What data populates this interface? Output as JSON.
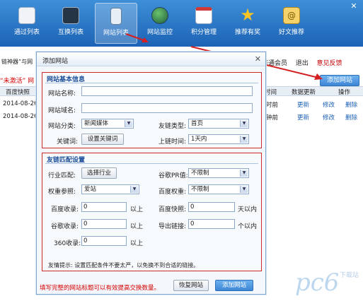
{
  "toolbar": {
    "items": [
      {
        "label": "通过列表",
        "icon": "clipboard-icon"
      },
      {
        "label": "互换列表",
        "icon": "monitor-icon"
      },
      {
        "label": "网站列表",
        "icon": "phone-icon"
      },
      {
        "label": "网站监控",
        "icon": "globe-icon"
      },
      {
        "label": "积分管理",
        "icon": "calendar-icon"
      },
      {
        "label": "推荐有奖",
        "icon": "star-icon"
      },
      {
        "label": "好文推荐",
        "icon": "mail-icon"
      }
    ],
    "active_index": 2
  },
  "background": {
    "app_title_fragment": "链神器”与网",
    "unactivated_text": "“未激活” 网",
    "header_left": "百度快照",
    "rows": [
      {
        "date": "2014-08-26",
        "time": "时前",
        "update": "更新",
        "edit": "修改",
        "delete": "删除"
      },
      {
        "date": "2014-08-26",
        "time": "钟前",
        "update": "更新",
        "edit": "修改",
        "delete": "删除"
      }
    ],
    "top_right": {
      "member": "普通会员",
      "logout": "退出",
      "feedback": "意见反馈"
    },
    "add_site_button": "添加网站",
    "columns": {
      "time": "时间",
      "data_update": "数据更新",
      "action": "操作"
    }
  },
  "dialog": {
    "title": "添加网站",
    "basic": {
      "group_title": "网站基本信息",
      "site_name_label": "网站名称:",
      "site_name_value": "",
      "site_alias_label": "网站域名:",
      "site_alias_value": "",
      "category_label": "网站分类:",
      "category_value": "新闻媒体",
      "link_type_label": "友链类型:",
      "link_type_value": "首页",
      "keyword_label": "关键词:",
      "keyword_button": "设置关键词",
      "link_time_label": "上链时间:",
      "link_time_value": "1天内"
    },
    "match": {
      "group_title": "友链匹配设置",
      "industry_label": "行业匹配:",
      "industry_button": "选择行业",
      "pr_label": "谷歌PR值:",
      "pr_value": "不限制",
      "weight_ref_label": "权重参照:",
      "weight_ref_value": "爱站",
      "baidu_weight_label": "百度权重:",
      "baidu_weight_value": "不限制",
      "baidu_index_label": "百度收录:",
      "baidu_index_value": "0",
      "baidu_index_unit": "以上",
      "baidu_snapshot_label": "百度快照:",
      "baidu_snapshot_value": "0",
      "baidu_snapshot_unit": "天以内",
      "google_index_label": "谷歌收录:",
      "google_index_value": "0",
      "google_index_unit": "以上",
      "outlinks_label": "导出链接:",
      "outlinks_value": "0",
      "outlinks_unit": "个以内",
      "s360_label": "360收录:",
      "s360_value": "0",
      "s360_unit": "以上",
      "tip": "友情提示: 设置匹配条件不要太严，以免换不到合适的链接。"
    },
    "footer_note": "填写完整的网站标题可以有效提高交换数量。",
    "restore_button": "恢复网站",
    "add_button": "添加网站"
  },
  "watermark": {
    "brand": "pc6",
    "line1": "下载站",
    "line2": ""
  },
  "colors": {
    "toolbar": "#1d63b5",
    "accent_red": "#d40000",
    "link_blue": "#1a5fb4"
  }
}
